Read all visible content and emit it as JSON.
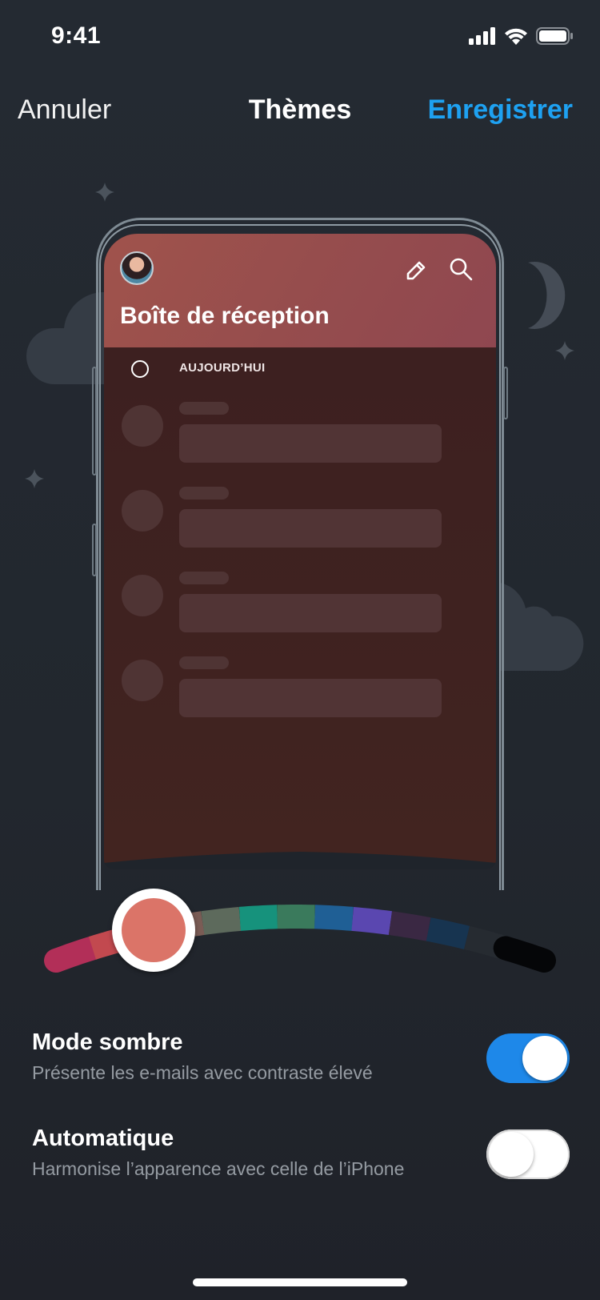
{
  "status_bar": {
    "time": "9:41",
    "icons": [
      "cellular-signal-icon",
      "wifi-icon",
      "battery-icon"
    ]
  },
  "nav": {
    "cancel_label": "Annuler",
    "title": "Thèmes",
    "save_label": "Enregistrer",
    "accent_color": "#1ea1f1"
  },
  "preview": {
    "inbox_title": "Boîte de réception",
    "section_label": "AUJOURD’HUI",
    "header_icons": [
      "compose-pencil-icon",
      "search-icon"
    ],
    "header_color": "#9a504d",
    "body_color": "#3e2121",
    "skeleton_rows": 4
  },
  "theme_slider": {
    "selected_index": 2,
    "selected_color": "#db7468",
    "swatches": [
      "#b22f58",
      "#c2494f",
      "#db7468",
      "#7a5c55",
      "#5d6a5c",
      "#16927c",
      "#3a7a5c",
      "#1f5f95",
      "#5a47b0",
      "#3a2843",
      "#173450",
      "#262b31",
      "#050608"
    ]
  },
  "settings": [
    {
      "title": "Mode sombre",
      "subtitle": "Présente les e-mails avec contraste élevé",
      "enabled": true
    },
    {
      "title": "Automatique",
      "subtitle": "Harmonise l’apparence avec celle de l’iPhone",
      "enabled": false
    }
  ],
  "toggle_on_color": "#1e88e9"
}
